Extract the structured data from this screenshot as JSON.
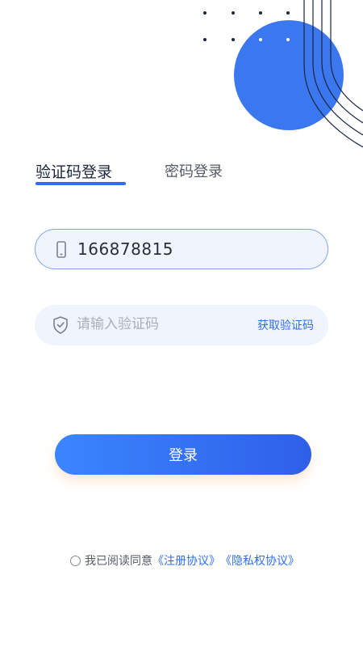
{
  "tabs": {
    "active_label": "验证码登录",
    "inactive_label": "密码登录"
  },
  "phone_field": {
    "value": "166878815",
    "icon": "phone-icon"
  },
  "code_field": {
    "placeholder": "请输入验证码",
    "icon": "shield-check-icon",
    "get_code_label": "获取验证码"
  },
  "login_button": {
    "label": "登录"
  },
  "agreement": {
    "prefix": "我已阅读同意",
    "terms_link": "《注册协议》",
    "privacy_link": "《隐私权协议》"
  },
  "colors": {
    "accent": "#2f6ef2",
    "circle": "#3b78f0",
    "field_bg": "#f0f4fc",
    "text_dark": "#1a2540"
  }
}
